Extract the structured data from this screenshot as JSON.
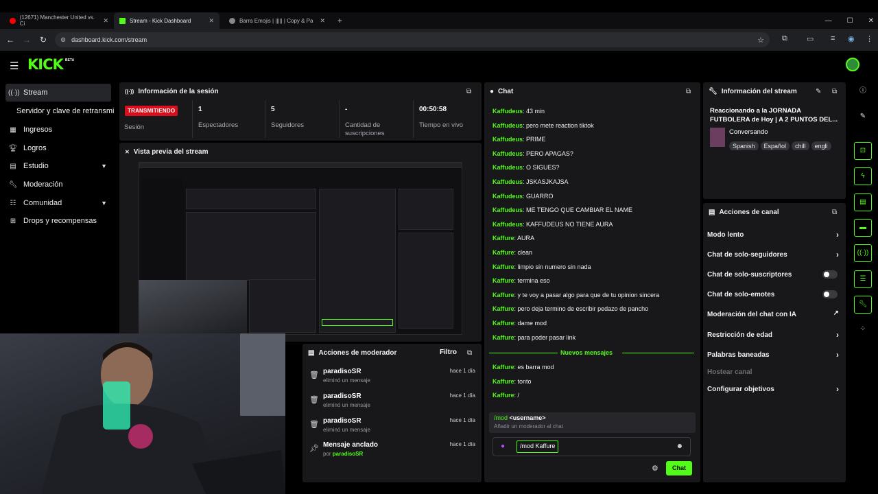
{
  "browser": {
    "tabs": [
      {
        "label": "(12671) Manchester United vs. Ci",
        "color": "#ff0000"
      },
      {
        "label": "Stream - Kick Dashboard",
        "color": "#53fc18"
      },
      {
        "label": "Barra Emojis | ||||| | Copy & Pa",
        "color": "#888888"
      }
    ],
    "new_tab": "+",
    "url": "dashboard.kick.com/stream",
    "win_min": "—",
    "win_max": "☐",
    "win_close": "✕"
  },
  "header": {
    "logo": "KICK",
    "beta": "BETA",
    "menu_icon": "hamburger-icon"
  },
  "sidebar": {
    "items": [
      {
        "label": "Stream",
        "icon": "broadcast-icon"
      },
      {
        "label": "Servidor y clave de retransmi"
      },
      {
        "label": "Ingresos",
        "icon": "chart-icon"
      },
      {
        "label": "Logros",
        "icon": "trophy-icon"
      },
      {
        "label": "Estudio",
        "icon": "studio-icon"
      },
      {
        "label": "Moderación",
        "icon": "wrench-icon"
      },
      {
        "label": "Comunidad",
        "icon": "users-icon"
      },
      {
        "label": "Drops y recompensas",
        "icon": "gift-icon"
      }
    ]
  },
  "session": {
    "title": "Información de la sesión",
    "live_badge": "TRANSMITIENDO",
    "session_label": "Sesión",
    "stats": [
      {
        "value": "1",
        "label": "Espectadores"
      },
      {
        "value": "5",
        "label": "Seguidores"
      },
      {
        "value": "-",
        "label": "Cantidad de suscripciones"
      },
      {
        "value": "00:50:58",
        "label": "Tiempo en vivo"
      }
    ]
  },
  "preview": {
    "title": "Vista previa del stream"
  },
  "modactions": {
    "title": "Acciones de moderador",
    "filter": "Filtro",
    "rows": [
      {
        "user": "paradisoSR",
        "action": "eliminó un mensaje",
        "time": "hace 1 día",
        "icon": "trash-icon"
      },
      {
        "user": "paradisoSR",
        "action": "eliminó un mensaje",
        "time": "hace 1 día",
        "icon": "trash-icon"
      },
      {
        "user": "paradisoSR",
        "action": "eliminó un mensaje",
        "time": "hace 1 día",
        "icon": "trash-icon"
      }
    ],
    "pinned": {
      "title": "Mensaje anclado",
      "by": "por",
      "user": "paradisoSR",
      "time": "hace 1 día"
    }
  },
  "chat": {
    "title": "Chat",
    "messages": [
      {
        "user": "Kaffudeus",
        "text": "43 min"
      },
      {
        "user": "Kaffudeus",
        "text": "pero mete reaction tiktok"
      },
      {
        "user": "Kaffudeus",
        "text": "PRIME"
      },
      {
        "user": "Kaffudeus",
        "text": "PERO APAGAS?"
      },
      {
        "user": "Kaffudeus",
        "text": "O SIGUES?"
      },
      {
        "user": "Kaffudeus",
        "text": "JSKASJKAJSA"
      },
      {
        "user": "Kaffudeus",
        "text": "GUARRO"
      },
      {
        "user": "Kaffudeus",
        "text": "ME TENGO QUE CAMBIAR EL NAME"
      },
      {
        "user": "Kaffudeus",
        "text": "KAFFUDEUS NO TIENE AURA"
      },
      {
        "user": "Kaffure",
        "text": "AURA"
      },
      {
        "user": "Kaffure",
        "text": "clean"
      },
      {
        "user": "Kaffure",
        "text": "limpio sin numero sin nada"
      },
      {
        "user": "Kaffure",
        "text": "termina eso"
      },
      {
        "user": "Kaffure",
        "text": "y te voy a pasar algo para que de tu opinion sincera"
      },
      {
        "user": "Kaffure",
        "text": "pero deja termino de escribir pedazo de pancho"
      },
      {
        "user": "Kaffure",
        "text": "dame mod"
      },
      {
        "user": "Kaffure",
        "text": "para poder pasar link"
      }
    ],
    "new_messages": "Nuevos mensajes",
    "after": [
      {
        "user": "Kaffure",
        "text": "es barra mod"
      },
      {
        "user": "Kaffure",
        "text": "tonto"
      },
      {
        "user": "Kaffure",
        "text": "/"
      }
    ],
    "suggestion": {
      "cmd": "/mod",
      "arg": "<username>",
      "desc": "Añadir un moderador al chat"
    },
    "input_value": "/mod Kaffure",
    "send": "Chat"
  },
  "streaminfo": {
    "title": "Información del stream",
    "stream_title": "Reaccionando a la JORNADA FUTBOLERA de Hoy | A 2 PUNTOS DEL...",
    "category": "Conversando",
    "tags": [
      "Spanish",
      "Español",
      "chill",
      "engli"
    ]
  },
  "actions": {
    "title": "Acciones de canal",
    "items": [
      {
        "label": "Modo lento",
        "control": "arrow"
      },
      {
        "label": "Chat de solo-seguidores",
        "control": "arrow"
      },
      {
        "label": "Chat de solo-suscriptores",
        "control": "toggle"
      },
      {
        "label": "Chat de solo-emotes",
        "control": "toggle"
      },
      {
        "label": "Moderación del chat con IA",
        "control": "ext"
      },
      {
        "label": "Restricción de edad",
        "control": "arrow"
      },
      {
        "label": "Palabras baneadas",
        "control": "arrow"
      },
      {
        "label": "Hostear canal",
        "control": "disabled"
      },
      {
        "label": "Configurar objetivos",
        "control": "arrow"
      }
    ]
  },
  "colors": {
    "brand": "#53fc18",
    "live": "#d90f1d",
    "panel": "#18181b"
  }
}
